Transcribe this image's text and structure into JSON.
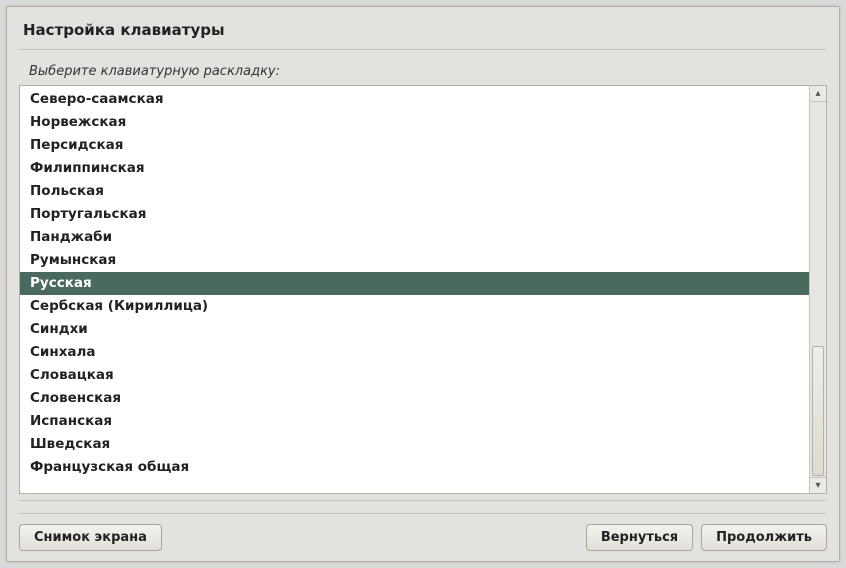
{
  "title": "Настройка клавиатуры",
  "prompt": "Выберите клавиатурную раскладку:",
  "layouts": [
    {
      "label": "Северо-саамская",
      "selected": false
    },
    {
      "label": "Норвежская",
      "selected": false
    },
    {
      "label": "Персидская",
      "selected": false
    },
    {
      "label": "Филиппинская",
      "selected": false
    },
    {
      "label": "Польская",
      "selected": false
    },
    {
      "label": "Португальская",
      "selected": false
    },
    {
      "label": "Панджаби",
      "selected": false
    },
    {
      "label": "Румынская",
      "selected": false
    },
    {
      "label": "Русская",
      "selected": true
    },
    {
      "label": "Сербская (Кириллица)",
      "selected": false
    },
    {
      "label": "Синдхи",
      "selected": false
    },
    {
      "label": "Синхала",
      "selected": false
    },
    {
      "label": "Словацкая",
      "selected": false
    },
    {
      "label": "Словенская",
      "selected": false
    },
    {
      "label": "Испанская",
      "selected": false
    },
    {
      "label": "Шведская",
      "selected": false
    },
    {
      "label": "Французская общая",
      "selected": false
    }
  ],
  "buttons": {
    "screenshot": "Снимок экрана",
    "back": "Вернуться",
    "continue": "Продолжить"
  },
  "scroll_glyphs": {
    "up": "▴",
    "down": "▾"
  }
}
